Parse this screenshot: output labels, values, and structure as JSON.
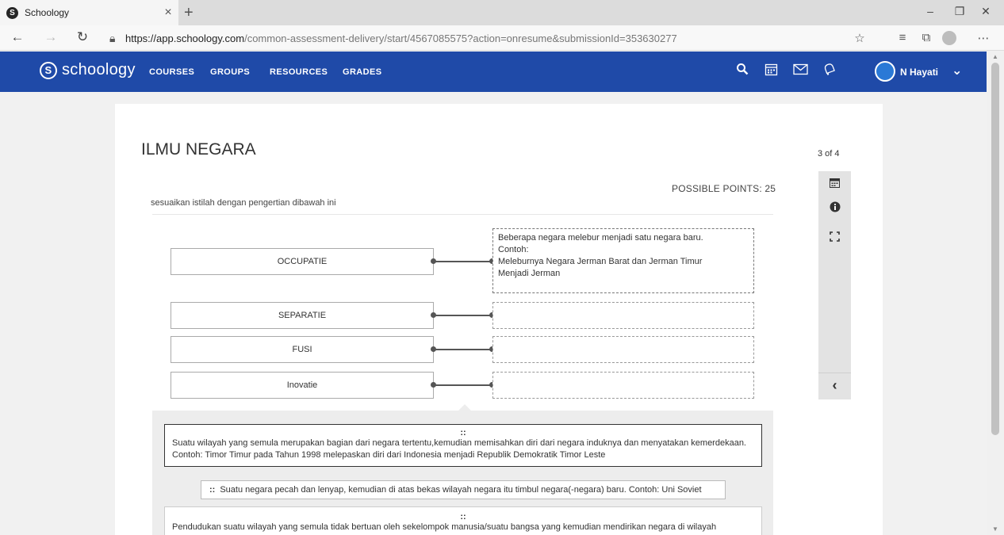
{
  "browser": {
    "tab_title": "Schoology",
    "tab_favicon": "S",
    "close_tab": "×",
    "new_tab": "+",
    "url_host": "https://app.schoology.com",
    "url_path": "/common-assessment-delivery/start/4567085575?action=onresume&submissionId=353630277",
    "icons": [
      "back-icon",
      "forward-icon",
      "refresh-icon",
      "lock-icon",
      "star-icon",
      "favorites-icon",
      "collections-icon",
      "profile-icon",
      "more-icon"
    ]
  },
  "header": {
    "logo_text": "schoology",
    "nav": [
      "COURSES",
      "GROUPS",
      "RESOURCES",
      "GRADES"
    ],
    "user_name": "N Hayati",
    "brand_color": "#1f4aa8"
  },
  "assessment": {
    "title": "ILMU NEGARA",
    "question_position": "3 of 4",
    "possible_points": "POSSIBLE POINTS: 25",
    "prompt": "sesuaikan istilah dengan pengertian dibawah ini",
    "terms": [
      "OCCUPATIE",
      "SEPARATIE",
      "FUSI",
      "Inovatie"
    ],
    "matched_answer": [
      "Beberapa negara melebur menjadi satu negara baru.",
      "Contoh:",
      "Meleburnya Negara Jerman Barat dan Jerman Timur",
      "Menjadi Jerman"
    ],
    "answer_bank": [
      "Suatu wilayah yang semula merupakan bagian dari negara tertentu,kemudian memisahkan diri dari negara induknya dan menyatakan kemerdekaan. Contoh:  Timor Timur pada Tahun 1998 melepaskan diri dari Indonesia menjadi Republik Demokratik Timor Leste",
      "Suatu negara pecah dan lenyap, kemudian di atas bekas wilayah negara itu timbul negara(-negara) baru. Contoh: Uni Soviet",
      "Pendudukan suatu wilayah yang semula tidak bertuan oleh sekelompok manusia/suatu bangsa yang kemudian mendirikan negara di wilayah"
    ],
    "grip": "::",
    "rail_collapse": "‹"
  }
}
